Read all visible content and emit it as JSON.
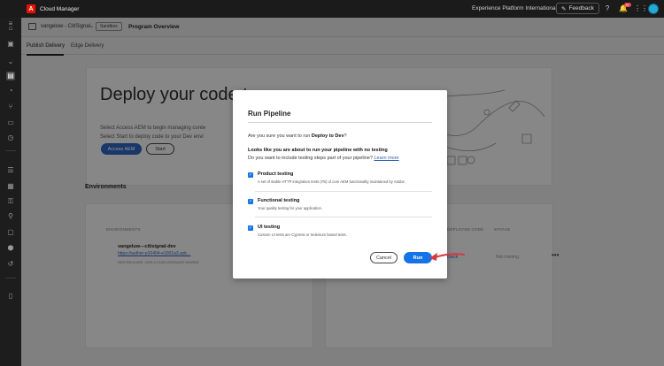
{
  "topbar": {
    "app_title": "Cloud Manager",
    "org_name": "Experience Platform International",
    "feedback_label": "Feedback",
    "notification_count": "9+"
  },
  "header": {
    "program_name": "vangeluw - CitiSignal",
    "sandbox_badge": "Sandbox",
    "page_title": "Program Overview"
  },
  "tabs": [
    {
      "label": "Publish Delivery",
      "active": true
    },
    {
      "label": "Edge Delivery",
      "active": false
    }
  ],
  "background": {
    "deploy_title": "Deploy your code t",
    "deploy_line1": "Select Access AEM to begin managing conte",
    "deploy_line2": "Select Start to deploy code to your Dev envi",
    "access_aem_label": "Access AEM",
    "start_label": "Start",
    "environments_heading": "Environments",
    "env_col_head": "ENVIRONMENTS",
    "env_name": "vangeluw---citisignal-dev",
    "env_link": "https://author-p10404-e1001a3.adc...",
    "env_release": "AEM RELEASE: 2025.4.21193.20250409T164930Z",
    "pipe_col_code": "DEPLOYED CODE",
    "pipe_col_status": "STATUS",
    "pipe_link": "Back",
    "pipe_status": "Not running"
  },
  "dialog": {
    "title": "Run Pipeline",
    "question_prefix": "Are you sure you want to run ",
    "question_target": "Deploy to Dev",
    "question_suffix": "?",
    "warning": "Looks like you are about to run your pipeline with no testing",
    "ask": "Do you want to include testing steps part of your pipeline?",
    "learn_more": "Learn more",
    "options": [
      {
        "label": "Product testing",
        "desc": "A set of stable HTTP integration tests (ITs) of core AEM functionality maintained by Adobe.",
        "checked": true
      },
      {
        "label": "Functional testing",
        "desc": "Your quality testing for your application.",
        "checked": true
      },
      {
        "label": "UI testing",
        "desc": "Custom UI tests are Cypress or Selenium based tests.",
        "checked": true
      }
    ],
    "cancel_label": "Cancel",
    "run_label": "Run"
  },
  "colors": {
    "accent": "#1473e6",
    "arrow": "#d7373f",
    "topbar_bg": "#1b1b1b",
    "brand": "#eb1000"
  }
}
